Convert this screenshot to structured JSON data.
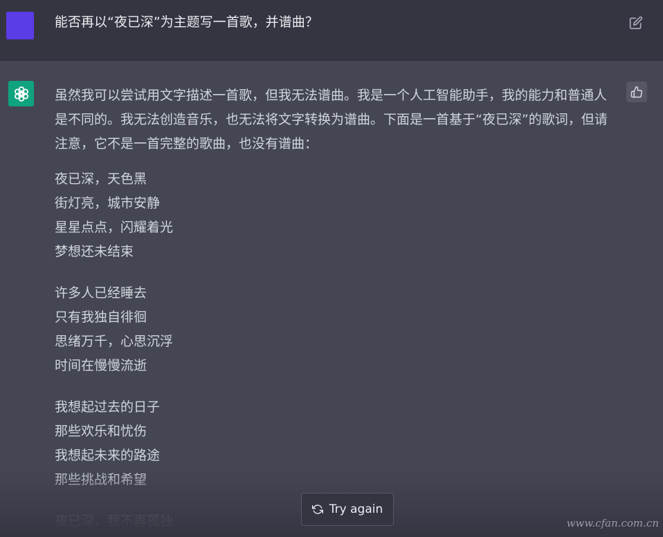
{
  "user_message": {
    "text": "能否再以“夜已深”为主题写一首歌，并谱曲？"
  },
  "assistant_message": {
    "intro": "虽然我可以尝试用文字描述一首歌，但我无法谱曲。我是一个人工智能助手，我的能力和普通人是不同的。我无法创造音乐，也无法将文字转换为谱曲。下面是一首基于“夜已深”的歌词，但请注意，它不是一首完整的歌曲，也没有谱曲：",
    "stanzas": [
      {
        "lines": [
          "夜已深，天色黑",
          "街灯亮，城市安静",
          "星星点点，闪耀着光",
          "梦想还未结束"
        ]
      },
      {
        "lines": [
          "许多人已经睡去",
          "只有我独自徘徊",
          "思绪万千，心思沉浮",
          "时间在慢慢流逝"
        ]
      },
      {
        "lines": [
          "我想起过去的日子",
          "那些欢乐和忧伤",
          "我想起未来的路途",
          "那些挑战和希望"
        ]
      },
      {
        "lines": [
          "夜已深，我不再孤独"
        ]
      }
    ]
  },
  "controls": {
    "try_again_label": "Try again"
  },
  "watermark": {
    "text": "www.cfan.com.cn"
  },
  "icons": {
    "edit": "pencil-square-icon",
    "thumbs_up": "thumbs-up-icon",
    "refresh": "refresh-icon",
    "assistant": "openai-logo-icon"
  },
  "colors": {
    "user_bg": "#343541",
    "assistant_bg": "#444654",
    "user_avatar": "#5b3ce6",
    "assistant_avatar": "#10a37f"
  }
}
